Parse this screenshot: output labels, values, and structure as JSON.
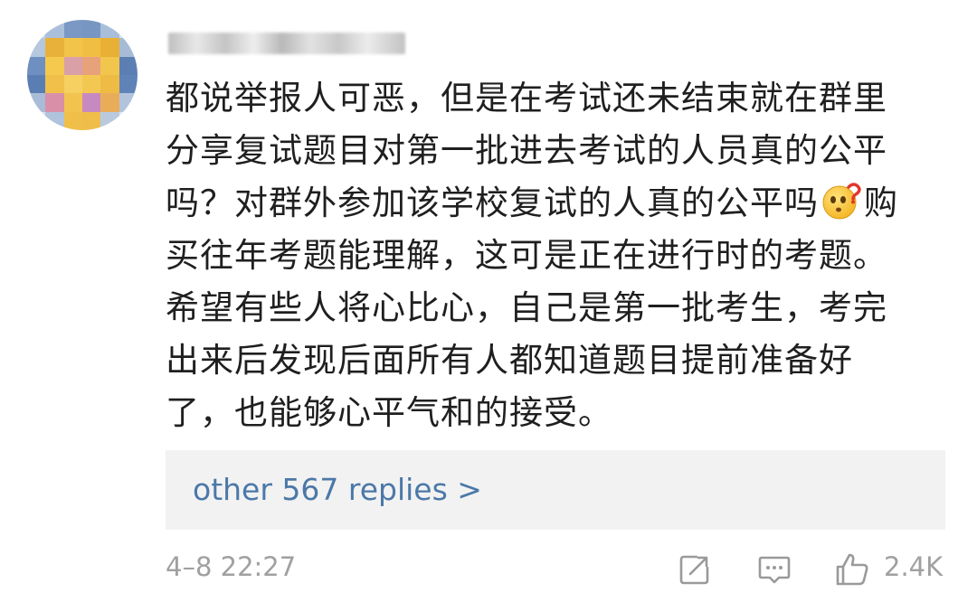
{
  "user": {
    "avatar_icon": "pixelated-avatar",
    "username_obscured": true
  },
  "comment": {
    "lines": [
      "都说举报人可恶，但是在考试还未结束就在群里",
      "分享复试题目对第一批进去考试的人员真的公平",
      "吗？对群外参加该学校复试的人真的公平吗",
      "买往年考题能理解，这可是正在进行时的考题。",
      "希望有些人将心比心，自己是第一批考生，考完",
      "出来后发现后面所有人都知道题目提前准备好",
      "了，也能够心平气和的接受。"
    ],
    "line3_tail": "购",
    "emoji": "thinking-question-face"
  },
  "replies": {
    "label": "other 567 replies >"
  },
  "footer": {
    "timestamp": "4–8 22:27",
    "share_icon": "share-icon",
    "comment_icon": "comment-icon",
    "like_icon": "thumbs-up-icon",
    "like_count": "2.4K"
  },
  "colors": {
    "link": "#4b78a8",
    "meta": "#a0a0a0",
    "reply_bg": "#f2f2f2",
    "text": "#1f1f1f"
  }
}
